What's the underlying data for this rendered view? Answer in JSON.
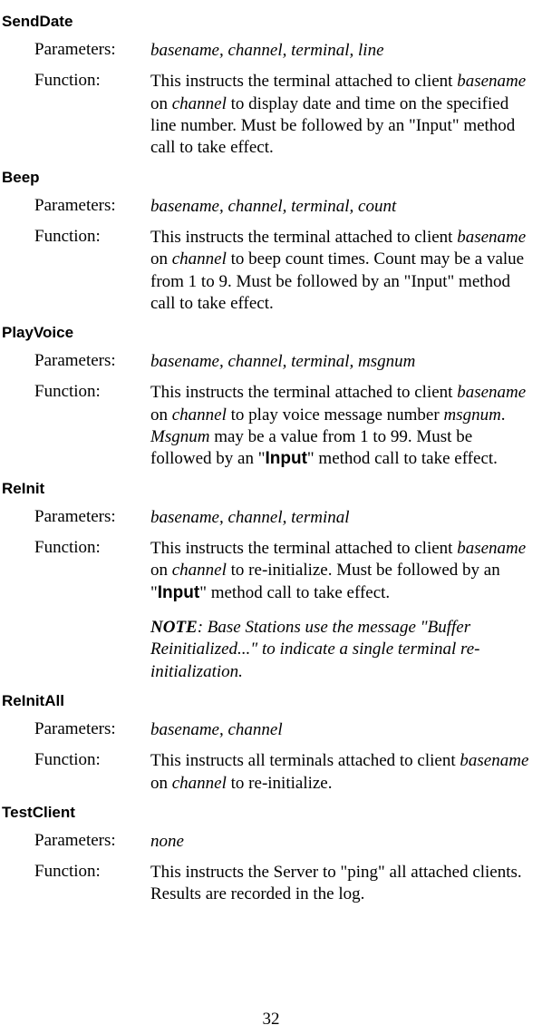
{
  "labels": {
    "parameters": "Parameters:",
    "function": "Function:"
  },
  "methods": {
    "senddate": {
      "name": "SendDate",
      "params": "basename, channel, terminal, line",
      "func_pre1": "This instructs the terminal attached to client ",
      "func_i1": "basename",
      "func_mid1": " on ",
      "func_i2": "channel",
      "func_post1": " to display date and time on the specified line number. Must be followed by an \"Input\" method call to take effect."
    },
    "beep": {
      "name": "Beep",
      "params": "basename, channel, terminal, count",
      "func_pre1": "This instructs the terminal attached to client ",
      "func_i1": "basename",
      "func_mid1": " on ",
      "func_i2": "channel",
      "func_post1": " to beep count times. Count may be a value from 1 to 9. Must be followed by an \"Input\" method call to take effect."
    },
    "playvoice": {
      "name": "PlayVoice",
      "params": "basename, channel, terminal, msgnum",
      "func_pre1": "This instructs the terminal attached to client ",
      "func_i1": "basename",
      "func_mid1": " on ",
      "func_i2": "channel",
      "func_mid2": " to play voice message number ",
      "func_i3": "msgnum",
      "func_mid3": ". ",
      "func_i4": "Msgnum",
      "func_mid4": " may be a value from 1 to 99. Must be followed by an \"",
      "func_b1": "Input",
      "func_post1": "\" method call to take effect."
    },
    "reinit": {
      "name": "ReInit",
      "params": "basename, channel, terminal",
      "func_pre1": "This instructs the terminal attached to client ",
      "func_i1": "basename",
      "func_mid1": " on ",
      "func_i2": "channel",
      "func_mid2": " to re-initialize. Must be followed by an \"",
      "func_b1": "Input",
      "func_post1": "\" method call to take effect.",
      "note_b": "NOTE",
      "note_rest": ": Base Stations use the message \"Buffer Reinitialized...\" to indicate a single terminal re-initialization."
    },
    "reinitall": {
      "name": "ReInitAll",
      "params": "basename, channel",
      "func_pre1": "This instructs all terminals attached to client ",
      "func_i1": "basename",
      "func_mid1": " on ",
      "func_i2": "channel",
      "func_post1": " to re-initialize."
    },
    "testclient": {
      "name": "TestClient",
      "params": "none",
      "func": "This instructs the Server to \"ping\" all attached clients. Results are recorded in the log."
    }
  },
  "page_number": "32"
}
